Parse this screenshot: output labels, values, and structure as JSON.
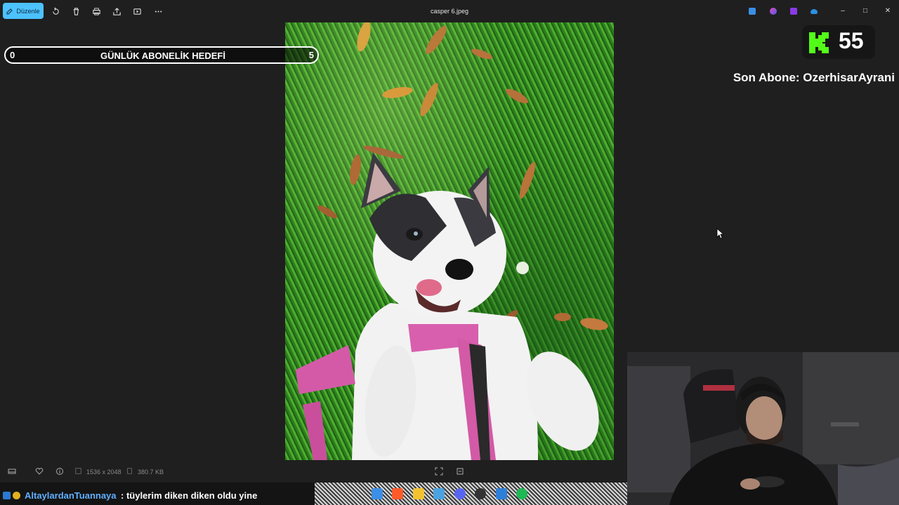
{
  "toolbar": {
    "edit_label": "Düzenle",
    "icons": [
      "rotate-icon",
      "delete-icon",
      "print-icon",
      "share-icon",
      "slideshow-icon",
      "more-icon"
    ]
  },
  "window": {
    "title": "casper 6.jpeg",
    "controls": [
      "minimize",
      "restore",
      "close"
    ]
  },
  "overlay": {
    "goal_min": "0",
    "goal_title": "GÜNLÜK ABONELİK HEDEFİ",
    "goal_max": "5",
    "kick_count": "55",
    "last_sub": "Son Abone: OzerhisarAyrani"
  },
  "status": {
    "dimensions": "1536 x 2048",
    "file_size": "380.7 KB"
  },
  "chat": {
    "user": "AltaylardanTuannaya",
    "message": ": tüylerim diken diken oldu yine"
  },
  "colors": {
    "accent": "#4cc2ff",
    "kick_green": "#53fc18",
    "chat_user": "#5fb0ff"
  }
}
